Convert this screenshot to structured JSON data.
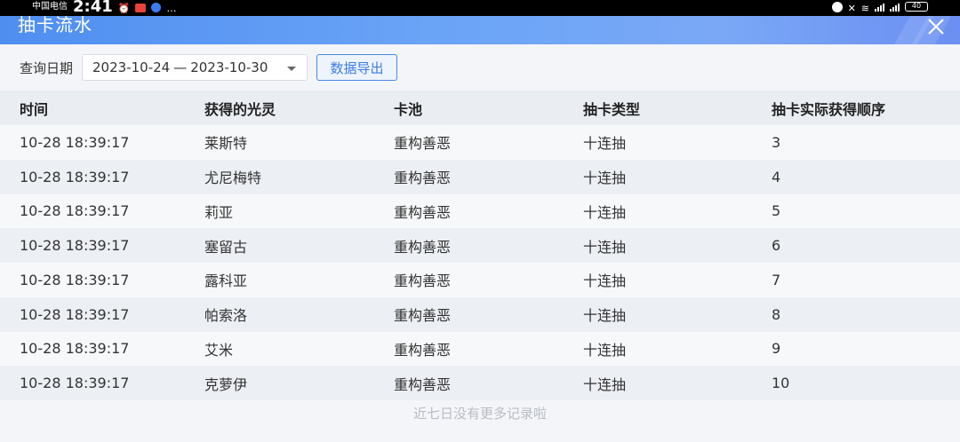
{
  "status_bar": {
    "carrier": "中国电信",
    "time": "2:41",
    "battery": "40"
  },
  "header": {
    "title": "抽卡流水"
  },
  "filter": {
    "label": "查询日期",
    "date_start": "2023-10-24",
    "date_separator": "—",
    "date_end": "2023-10-30",
    "export_label": "数据导出"
  },
  "table": {
    "columns": [
      "时间",
      "获得的光灵",
      "卡池",
      "抽卡类型",
      "抽卡实际获得顺序"
    ],
    "rows": [
      [
        "10-28 18:39:17",
        "莱斯特",
        "重构善恶",
        "十连抽",
        "3"
      ],
      [
        "10-28 18:39:17",
        "尤尼梅特",
        "重构善恶",
        "十连抽",
        "4"
      ],
      [
        "10-28 18:39:17",
        "莉亚",
        "重构善恶",
        "十连抽",
        "5"
      ],
      [
        "10-28 18:39:17",
        "塞留古",
        "重构善恶",
        "十连抽",
        "6"
      ],
      [
        "10-28 18:39:17",
        "露科亚",
        "重构善恶",
        "十连抽",
        "7"
      ],
      [
        "10-28 18:39:17",
        "帕索洛",
        "重构善恶",
        "十连抽",
        "8"
      ],
      [
        "10-28 18:39:17",
        "艾米",
        "重构善恶",
        "十连抽",
        "9"
      ],
      [
        "10-28 18:39:17",
        "克萝伊",
        "重构善恶",
        "十连抽",
        "10"
      ]
    ]
  },
  "footer": {
    "note": "近七日没有更多记录啦"
  },
  "colors": {
    "accent": "#3b7be6",
    "header_gradient_start": "#4f8ef0",
    "header_gradient_end": "#6b8ff2"
  }
}
